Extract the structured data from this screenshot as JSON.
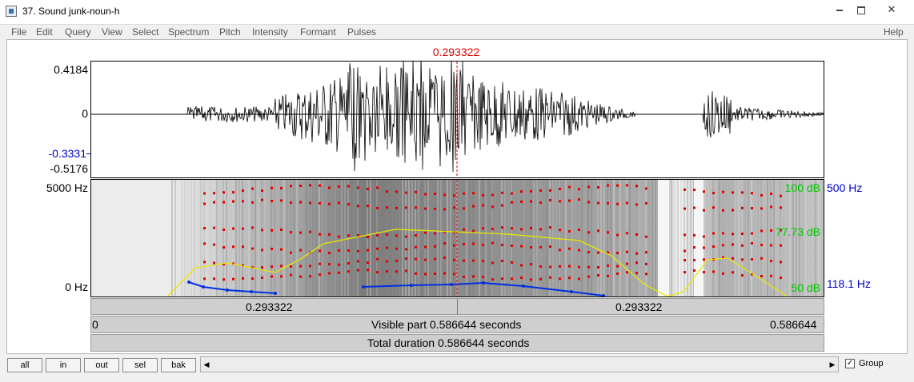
{
  "window": {
    "title": "37. Sound junk-noun-h",
    "minimize_icon": "minimize-icon",
    "maximize_icon": "maximize-icon",
    "close_icon": "close-icon"
  },
  "menu": {
    "items": [
      "File",
      "Edit",
      "Query",
      "View",
      "Select",
      "Spectrum",
      "Pitch",
      "Intensity",
      "Formant",
      "Pulses"
    ],
    "help": "Help"
  },
  "cursor": {
    "time_top": "0.293322",
    "color": "#e00000"
  },
  "waveform": {
    "max_label": "0.4184",
    "zero_label": "0",
    "cursor_value": "-0.3331",
    "min_label": "-0.5176"
  },
  "spectrogram": {
    "top_freq": "5000 Hz",
    "bottom_freq": "0 Hz",
    "intensity_top": "100 dB",
    "intensity_mid": "77.73 dB",
    "intensity_bottom": "50 dB",
    "pitch_top": "500 Hz",
    "pitch_bottom": "118.1 Hz",
    "colors": {
      "formant": "#e00000",
      "intensity": "#e8e800",
      "pitch": "#0030e0",
      "label_green": "#00c800",
      "label_blue": "#0000c8"
    }
  },
  "timebar": {
    "left_segment": "0.293322",
    "right_segment": "0.293322",
    "visible_start": "0",
    "visible_label": "Visible part 0.586644 seconds",
    "visible_end": "0.586644",
    "total_label": "Total duration 0.586644 seconds"
  },
  "buttons": {
    "all": "all",
    "in": "in",
    "out": "out",
    "sel": "sel",
    "bak": "bak"
  },
  "group": {
    "label": "Group",
    "checked": "✓"
  },
  "scroll": {
    "left_icon": "arrow-left-icon",
    "right_icon": "arrow-right-icon"
  }
}
